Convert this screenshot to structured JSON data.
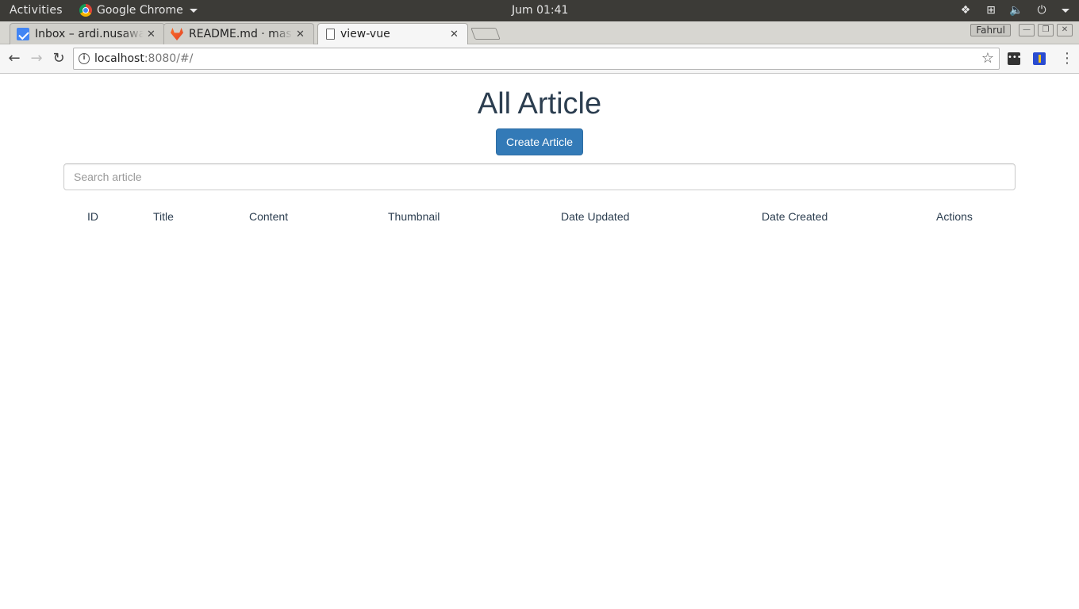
{
  "os_bar": {
    "activities": "Activities",
    "app_name": "Google Chrome",
    "clock": "Jum 01:41"
  },
  "browser": {
    "tabs": [
      {
        "title": "Inbox – ardi.nusawa",
        "icon": "inbox-icon"
      },
      {
        "title": "README.md · master",
        "icon": "gitlab-icon"
      },
      {
        "title": "view-vue",
        "icon": "page-icon"
      }
    ],
    "profile": "Fahrul",
    "url_host": "localhost",
    "url_rest": ":8080/#/"
  },
  "page": {
    "heading": "All Article",
    "create_button": "Create Article",
    "search_placeholder": "Search article",
    "table_headers": [
      "ID",
      "Title",
      "Content",
      "Thumbnail",
      "Date Updated",
      "Date Created",
      "Actions"
    ]
  }
}
